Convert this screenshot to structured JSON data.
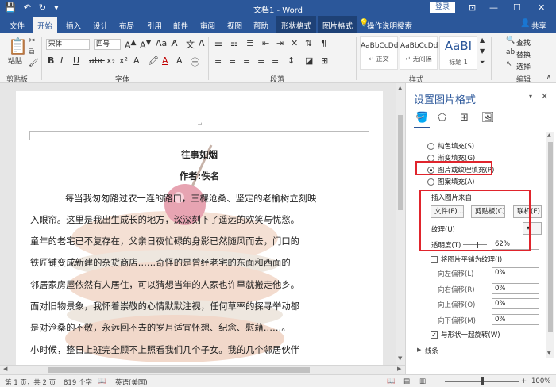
{
  "title_bar": {
    "title": "文档1 - Word",
    "login": "登录",
    "minimize": "—",
    "restore": "☐",
    "close": "✕",
    "ribbon_options": "⊡"
  },
  "tabs": {
    "file": "文件",
    "home": "开始",
    "insert": "插入",
    "design": "设计",
    "layout": "布局",
    "references": "引用",
    "mailings": "邮件",
    "review": "审阅",
    "view": "视图",
    "help": "帮助",
    "shape_format": "形状格式",
    "picture_format": "图片格式",
    "tell_me": "操作说明搜索",
    "share": "共享"
  },
  "ribbon": {
    "paste": "粘贴",
    "clipboard": "剪贴板",
    "font_name": "宋体",
    "font_size": "四号",
    "font_group": "字体",
    "paragraph_group": "段落",
    "styles_group": "样式",
    "editing_group": "编辑",
    "styles": [
      {
        "sample": "AaBbCcDd",
        "name": "↵ 正文"
      },
      {
        "sample": "AaBbCcDd",
        "name": "↵ 无间隔"
      },
      {
        "sample": "AaBI",
        "name": "标题 1"
      }
    ],
    "find": "查找",
    "replace": "替换",
    "select": "选择"
  },
  "document": {
    "title": "往事如烟",
    "author": "作者:佚名",
    "lines": [
      "每当我匆匆路过农一连的路口，三棵沧桑、坚定的老榆树立刻映",
      "入眼帘。这里是我出生成长的地方，深深刻下了遥远的欢笑与忧愁。",
      "童年的老宅已不复存在，父亲日夜忙碌的身影已然随风而去，门口的",
      "铁匠铺变成新建的杂货商店……奇怪的是曾经老宅的东面和西面的",
      "邻居家房屋依然有人居住，可以猜想当年的人家也许早就搬走他乡。",
      "面对旧物景象，我怀着崇敬的心情默默注视，任何草率的探寻举动都",
      "是对沧桑的不敬，永远回不去的岁月适宜怀想、纪念、慰藉……。",
      "小时候，整日上班完全顾不上照看我们几个子女。我的几个邻居伙伴"
    ]
  },
  "pane": {
    "title": "设置图片格式",
    "close": "✕",
    "options": [
      {
        "label": "纯色填充(S)",
        "checked": false
      },
      {
        "label": "渐变填充(G)",
        "checked": false
      },
      {
        "label": "图片或纹理填充(P)",
        "checked": true
      },
      {
        "label": "图案填充(A)",
        "checked": false
      }
    ],
    "insert_from": "插入图片来自",
    "file_btn": "文件(F)...",
    "clipboard_btn": "剪贴板(C)",
    "online_btn": "联机(E)...",
    "texture": "纹理(U)",
    "transparency": "透明度(T)",
    "transparency_value": "62%",
    "transparency_level": 0.62,
    "tile_checkbox": "将图片平铺为纹理(I)",
    "offsets": [
      {
        "label": "向左偏移(L)",
        "value": "0%"
      },
      {
        "label": "向右偏移(R)",
        "value": "0%"
      },
      {
        "label": "向上偏移(O)",
        "value": "0%"
      },
      {
        "label": "向下偏移(M)",
        "value": "0%"
      }
    ],
    "rotate_checkbox": "与形状一起旋转(W)",
    "line_section": "线条"
  },
  "status": {
    "page": "第 1 页，共 2 页",
    "words": "819 个字",
    "language": "英语(美国)",
    "zoom": "100%",
    "zoom_minus": "−",
    "zoom_plus": "+"
  }
}
